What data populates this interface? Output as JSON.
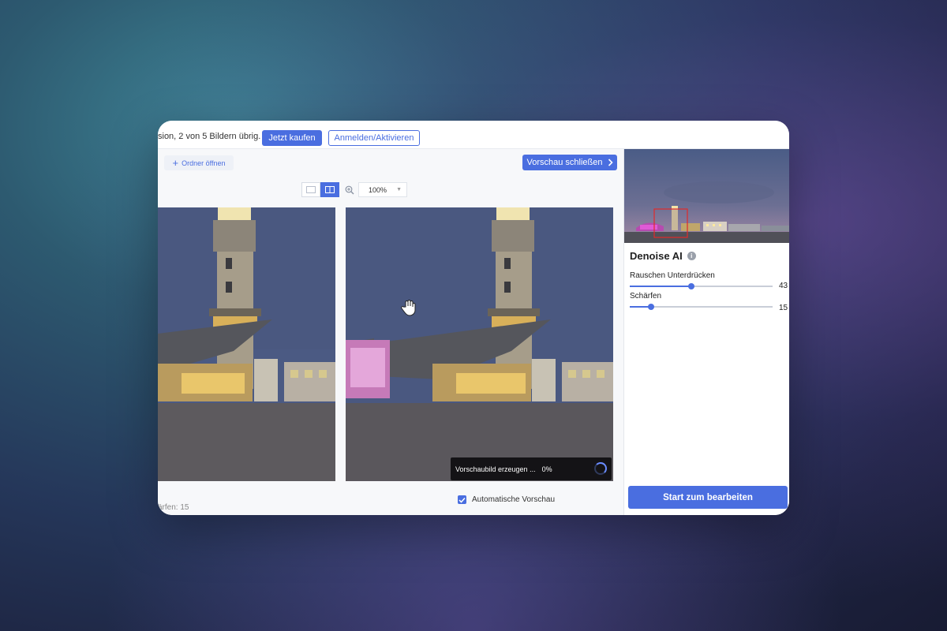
{
  "topbar": {
    "trial_text": "sion, 2 von 5 Bildern übrig.",
    "buy_label": "Jetzt kaufen",
    "login_label": "Anmelden/Aktivieren"
  },
  "toolbar": {
    "open_folder_label": "Ordner öffnen",
    "close_preview_label": "Vorschau schließen",
    "zoom_value": "100%"
  },
  "preview": {
    "progress_text": "Vorschaubild erzeugen ...",
    "progress_percent": "0%",
    "progress_value": 0
  },
  "bottom": {
    "left_text": "ärfen: 15",
    "auto_preview_label": "Automatische Vorschau",
    "auto_preview_checked": true
  },
  "panel": {
    "title": "Denoise AI",
    "sliders": [
      {
        "label": "Rauschen Unterdrücken",
        "value": 43,
        "display": "43",
        "fraction": 0.43
      },
      {
        "label": "Schärfen",
        "value": 15,
        "display": "15",
        "fraction": 0.15
      }
    ],
    "start_label": "Start zum bearbeiten"
  },
  "colors": {
    "accent": "#4a6ee0",
    "sky": "#4b5a83",
    "sand": "#5d5a5e"
  }
}
